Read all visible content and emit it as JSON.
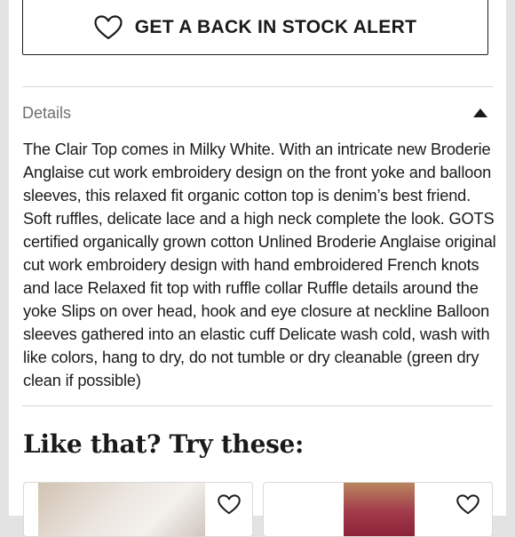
{
  "alert_button": {
    "label": "GET A BACK IN STOCK ALERT",
    "icon": "heart-icon"
  },
  "details": {
    "title": "Details",
    "toggle_icon": "caret-up-icon",
    "description": "The Clair Top comes in Milky White. With an intricate new Broderie Anglaise cut work embroidery design on the front yoke and balloon sleeves, this relaxed fit organic cotton top is denim’s best friend. Soft ruffles, delicate lace and a high neck complete the look. GOTS certified organically grown cotton Unlined Broderie Anglaise original cut work embroidery design with hand embroidered French knots and lace Relaxed fit top with ruffle collar Ruffle details around the yoke Slips on over head, hook and eye closure at neckline Balloon sleeves gathered into an elastic cuff Delicate wash cold, wash with like colors, hang to dry, do not tumble or dry cleanable (green dry clean if possible)"
  },
  "recommendations": {
    "title": "Like that? Try these:",
    "items": [
      {
        "favorite_icon": "heart-outline-icon",
        "image": "white-blouse-photo"
      },
      {
        "favorite_icon": "heart-outline-icon",
        "image": "red-top-photo"
      }
    ]
  },
  "colors": {
    "text": "#1a1a1a",
    "muted": "#6f6f6f",
    "divider": "#d6d6d6",
    "background": "#e3e3e3"
  }
}
